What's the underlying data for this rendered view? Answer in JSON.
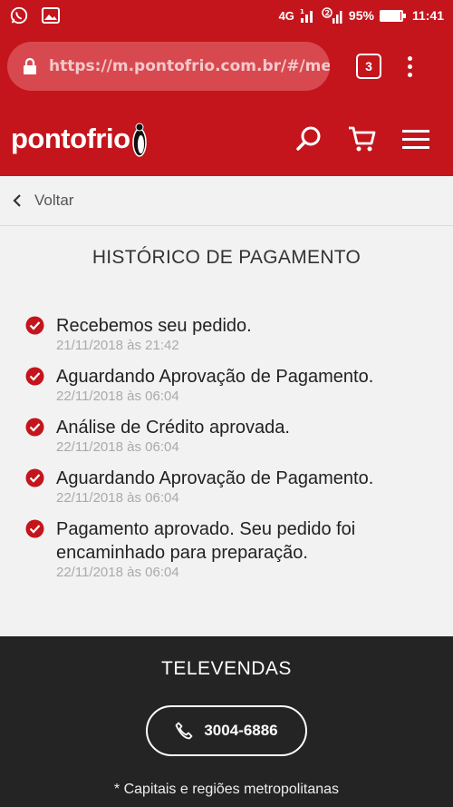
{
  "status_bar": {
    "network": "4G",
    "sim2": "2",
    "battery": "95%",
    "time": "11:41"
  },
  "browser": {
    "url": "https://m.pontofrio.com.br/#/me",
    "tab_count": "3"
  },
  "site": {
    "logo_text": "pontofrio"
  },
  "back": {
    "label": "Voltar"
  },
  "main": {
    "title": "HISTÓRICO DE PAGAMENTO",
    "history": [
      {
        "message": "Recebemos seu pedido.",
        "date": "21/11/2018 às 21:42"
      },
      {
        "message": "Aguardando Aprovação de Pagamento.",
        "date": "22/11/2018 às 06:04"
      },
      {
        "message": "Análise de Crédito aprovada.",
        "date": "22/11/2018 às 06:04"
      },
      {
        "message": "Aguardando Aprovação de Pagamento.",
        "date": "22/11/2018 às 06:04"
      },
      {
        "message": "Pagamento aprovado. Seu pedido foi encaminhado para preparação.",
        "date": "22/11/2018 às 06:04"
      }
    ]
  },
  "footer": {
    "title": "TELEVENDAS",
    "phone": "3004-6886",
    "note": "* Capitais e regiões metropolitanas"
  },
  "colors": {
    "brand_red": "#c4151c",
    "footer_bg": "#242424",
    "check_red": "#c4151c"
  }
}
